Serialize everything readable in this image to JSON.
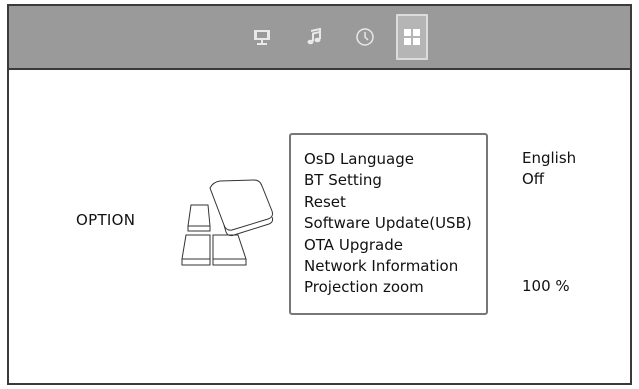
{
  "tabs": [
    {
      "icon": "monitor-icon",
      "active": false
    },
    {
      "icon": "music-note-icon",
      "active": false
    },
    {
      "icon": "clock-icon",
      "active": false
    },
    {
      "icon": "grid-icon",
      "active": true
    }
  ],
  "section": {
    "label": "OPTION"
  },
  "menu": {
    "items": [
      "OsD Language",
      "BT Setting",
      "Reset",
      "Software Update(USB)",
      "OTA Upgrade",
      "Network Information",
      "Projection zoom"
    ]
  },
  "values": {
    "osd_language": "English",
    "bt_setting": "Off",
    "projection_zoom": "100 %"
  },
  "colors": {
    "topbar": "#9a9a9a",
    "active_tab": "#b5b5b5",
    "icon": "#e8e8e8",
    "text": "#111111"
  }
}
